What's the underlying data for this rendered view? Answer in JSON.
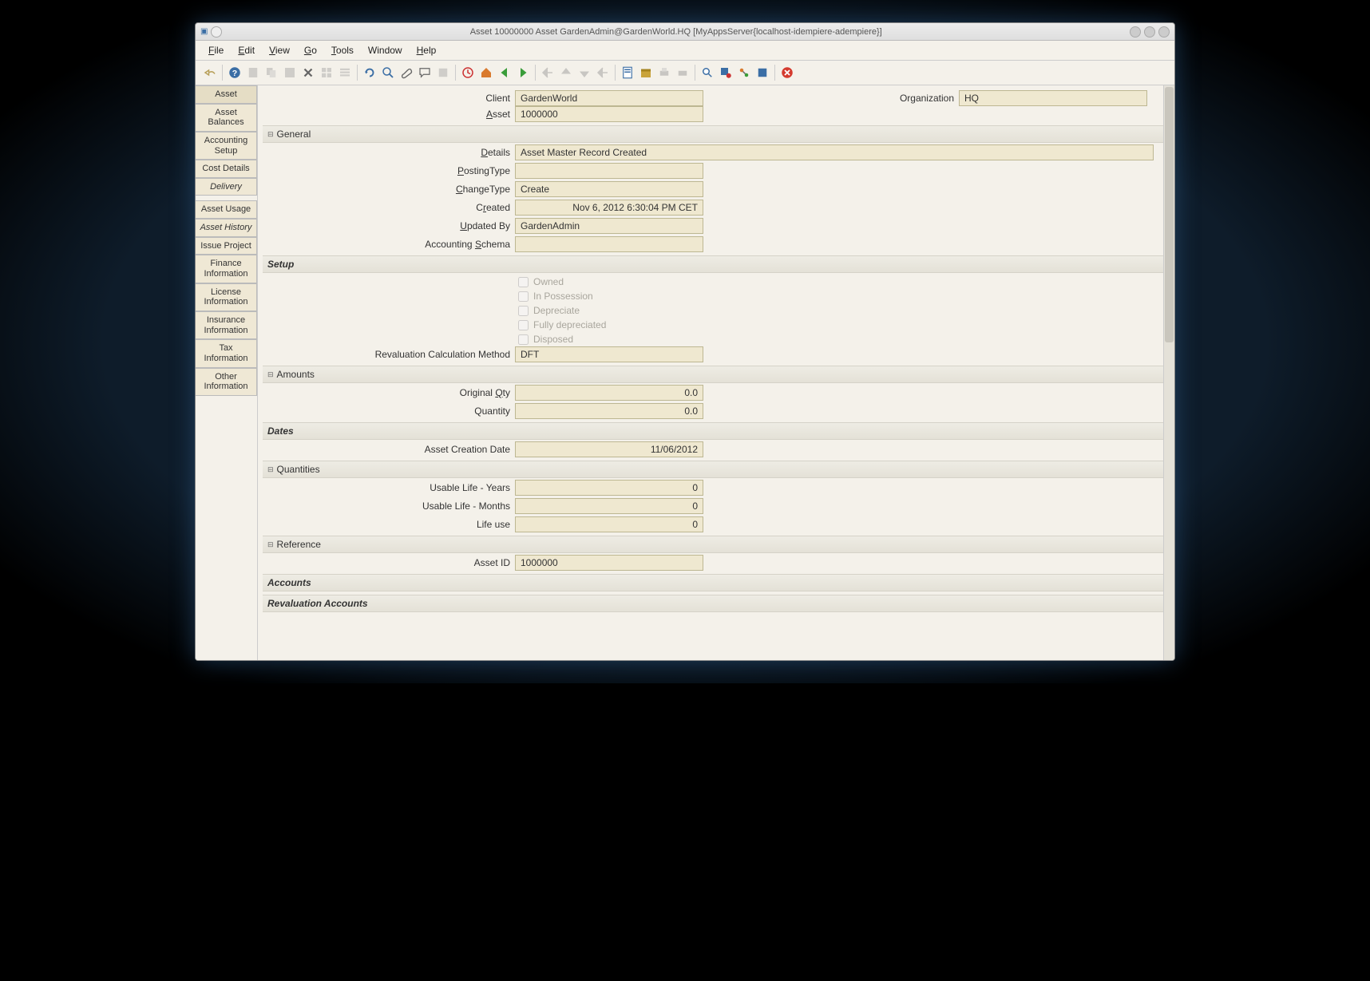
{
  "window": {
    "title": "Asset  10000000  Asset  GardenAdmin@GardenWorld.HQ [MyAppsServer{localhost-idempiere-adempiere}]"
  },
  "menu": {
    "file": "File",
    "edit": "Edit",
    "view": "View",
    "go": "Go",
    "tools": "Tools",
    "window": "Window",
    "help": "Help"
  },
  "sidebar": {
    "tabs": [
      {
        "label": "Asset",
        "active": true
      },
      {
        "label": "Asset Balances"
      },
      {
        "label": "Accounting Setup"
      },
      {
        "label": "Cost Details"
      },
      {
        "label": "Delivery",
        "italic": true
      },
      {
        "label": "Asset Usage"
      },
      {
        "label": "Asset History",
        "italic": true
      },
      {
        "label": "Issue Project"
      },
      {
        "label": "Finance Information"
      },
      {
        "label": "License Information"
      },
      {
        "label": "Insurance Information"
      },
      {
        "label": "Tax Information"
      },
      {
        "label": "Other Information"
      }
    ]
  },
  "header": {
    "client_label": "Client",
    "client": "GardenWorld",
    "org_label": "Organization",
    "org": "HQ",
    "asset_label": "Asset",
    "asset": "1000000"
  },
  "sections": {
    "general": "General",
    "setup": "Setup",
    "amounts": "Amounts",
    "dates": "Dates",
    "quantities": "Quantities",
    "reference": "Reference",
    "accounts": "Accounts",
    "reval": "Revaluation Accounts"
  },
  "general": {
    "details_label": "Details",
    "details": "Asset Master Record Created",
    "posting_label": "PostingType",
    "posting": "",
    "changetype_label": "ChangeType",
    "changetype": "Create",
    "created_label": "Created",
    "created": "Nov 6, 2012 6:30:04 PM CET",
    "updatedby_label": "Updated By",
    "updatedby": "GardenAdmin",
    "acctschema_label": "Accounting Schema",
    "acctschema": ""
  },
  "setup": {
    "owned": "Owned",
    "poss": "In Possession",
    "depr": "Depreciate",
    "fulldepr": "Fully depreciated",
    "disposed": "Disposed",
    "revalmethod_label": "Revaluation Calculation Method",
    "revalmethod": "DFT"
  },
  "amounts": {
    "origqty_label": "Original Qty",
    "origqty": "0.0",
    "qty_label": "Quantity",
    "qty": "0.0"
  },
  "dates": {
    "creation_label": "Asset Creation Date",
    "creation": "11/06/2012"
  },
  "quant": {
    "years_label": "Usable Life - Years",
    "years": "0",
    "months_label": "Usable Life - Months",
    "months": "0",
    "life_label": "Life use",
    "life": "0"
  },
  "ref": {
    "assetid_label": "Asset ID",
    "assetid": "1000000"
  }
}
